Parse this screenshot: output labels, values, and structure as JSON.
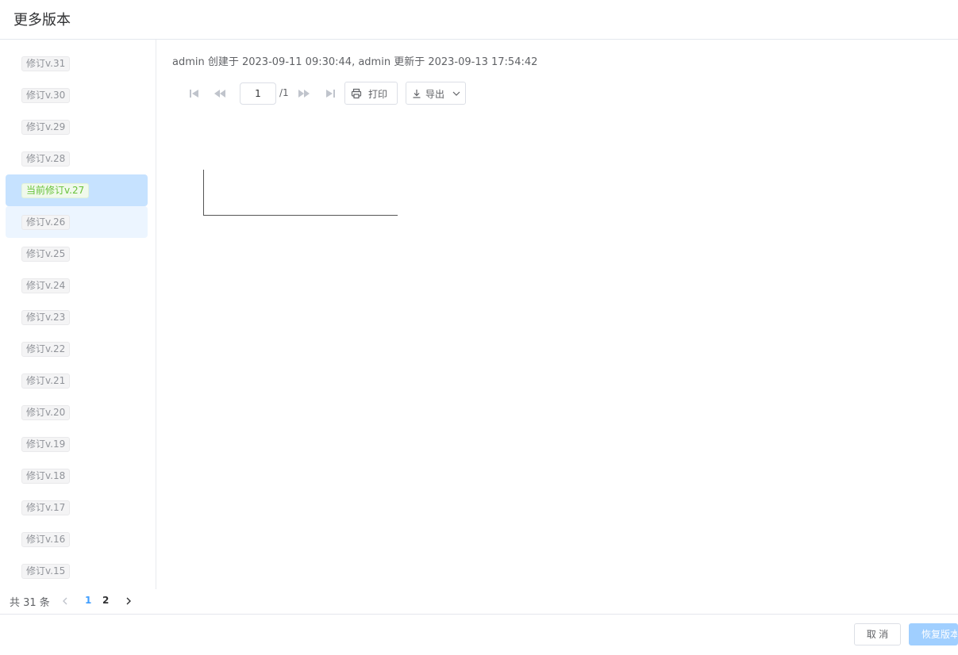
{
  "header": {
    "title": "更多版本"
  },
  "versions": [
    {
      "label": "修订v.31"
    },
    {
      "label": "修订v.30"
    },
    {
      "label": "修订v.29"
    },
    {
      "label": "修订v.28"
    },
    {
      "label": "当前修订v.27"
    },
    {
      "label": "修订v.26"
    },
    {
      "label": "修订v.25"
    },
    {
      "label": "修订v.24"
    },
    {
      "label": "修订v.23"
    },
    {
      "label": "修订v.22"
    },
    {
      "label": "修订v.21"
    },
    {
      "label": "修订v.20"
    },
    {
      "label": "修订v.19"
    },
    {
      "label": "修订v.18"
    },
    {
      "label": "修订v.17"
    },
    {
      "label": "修订v.16"
    },
    {
      "label": "修订v.15"
    }
  ],
  "meta": {
    "text": "admin 创建于 2023-09-11 09:30:44, admin 更新于 2023-09-13 17:54:42"
  },
  "toolbar": {
    "page_value": "1",
    "page_total": "/1",
    "print_label": "打印",
    "export_label": "导出"
  },
  "pagination": {
    "total_text": "共 31 条",
    "pages": [
      "1",
      "2"
    ],
    "current": "1"
  },
  "footer": {
    "cancel_label": "取 消",
    "restore_label": "恢复版本"
  },
  "colors": {
    "primary": "#409eff",
    "active_bg": "#c6e2ff",
    "hover_bg": "#ecf5ff",
    "current_tag": "#67c23a",
    "restore_disabled": "#a0cfff"
  }
}
